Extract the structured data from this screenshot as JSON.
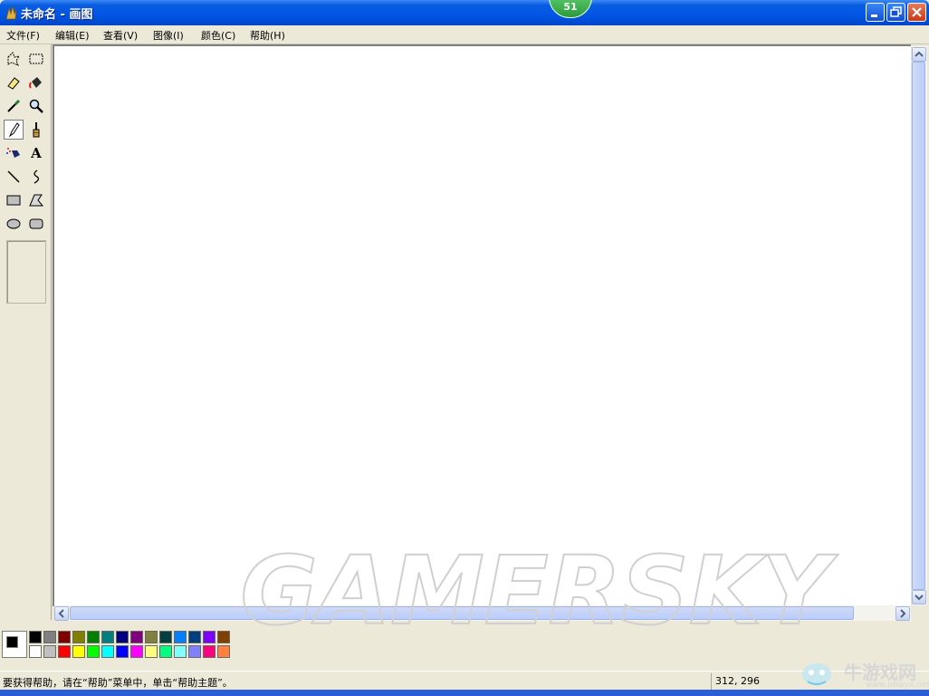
{
  "window": {
    "title": "未命名 - 画图",
    "badge": "51"
  },
  "menu": [
    "文件(F)",
    "编辑(E)",
    "查看(V)",
    "图像(I)",
    "颜色(C)",
    "帮助(H)"
  ],
  "tools": [
    {
      "name": "free-form-select-icon",
      "active": false
    },
    {
      "name": "select-icon",
      "active": false
    },
    {
      "name": "eraser-icon",
      "active": false
    },
    {
      "name": "fill-bucket-icon",
      "active": false
    },
    {
      "name": "color-picker-icon",
      "active": false
    },
    {
      "name": "magnifier-icon",
      "active": false
    },
    {
      "name": "pencil-icon",
      "active": true
    },
    {
      "name": "brush-icon",
      "active": false
    },
    {
      "name": "airbrush-icon",
      "active": false
    },
    {
      "name": "text-icon",
      "active": false
    },
    {
      "name": "line-icon",
      "active": false
    },
    {
      "name": "curve-icon",
      "active": false
    },
    {
      "name": "rectangle-icon",
      "active": false
    },
    {
      "name": "polygon-icon",
      "active": false
    },
    {
      "name": "ellipse-icon",
      "active": false
    },
    {
      "name": "rounded-rectangle-icon",
      "active": false
    }
  ],
  "palette": {
    "foreground": "#000000",
    "background": "#ffffff",
    "top_row": [
      "#000000",
      "#808080",
      "#800000",
      "#808000",
      "#008000",
      "#008080",
      "#000080",
      "#800080",
      "#808040",
      "#004040",
      "#0080ff",
      "#004080",
      "#8000ff",
      "#804000"
    ],
    "bottom_row": [
      "#ffffff",
      "#c0c0c0",
      "#ff0000",
      "#ffff00",
      "#00ff00",
      "#00ffff",
      "#0000ff",
      "#ff00ff",
      "#ffff80",
      "#00ff80",
      "#80ffff",
      "#8080ff",
      "#ff0080",
      "#ff8040"
    ]
  },
  "status": {
    "help_text": "要获得帮助，请在“帮助”菜单中，单击“帮助主题”。",
    "coordinates": "312, 296"
  },
  "watermark": {
    "text": "GAMERSKY",
    "logo_text": "牛游戏网",
    "logo_url": "www.newyx.net"
  }
}
